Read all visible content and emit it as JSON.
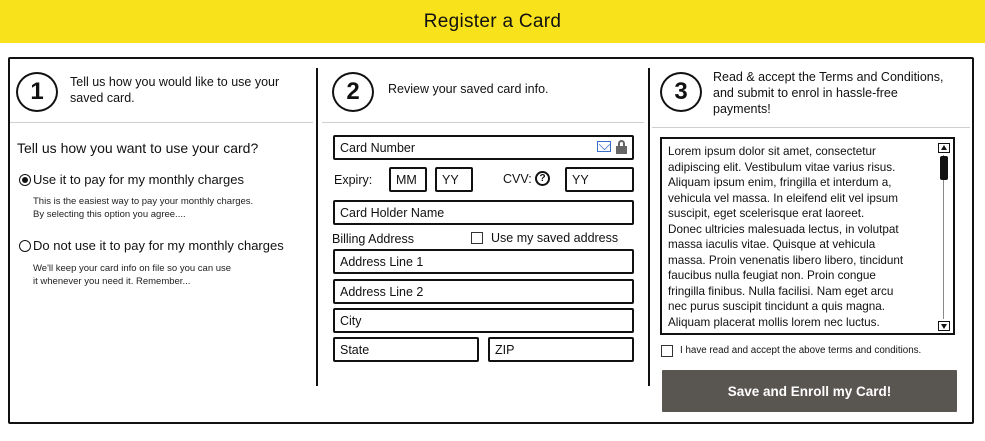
{
  "header": {
    "title": "Register a Card"
  },
  "step1": {
    "number": "1",
    "text_line1": "Tell us how you would like to use your",
    "text_line2": "saved card.",
    "question": "Tell us how you want to use your card?",
    "option1": {
      "label": "Use it to pay for my monthly charges",
      "selected": true,
      "desc_line1": "This is the easiest way to pay your monthly charges.",
      "desc_line2": "By selecting this option you agree...."
    },
    "option2": {
      "label": "Do not use it to pay for my monthly charges",
      "selected": false,
      "desc_line1": "We'll keep your card info on file so you can use",
      "desc_line2": "it whenever you need it. Remember..."
    }
  },
  "step2": {
    "number": "2",
    "text": "Review your saved card info.",
    "card_number": "Card Number",
    "expiry_label": "Expiry:",
    "expiry_month": "MM",
    "expiry_year": "YY",
    "cvv_label": "CVV:",
    "cvv_value": "YY",
    "card_holder": "Card Holder Name",
    "billing_label": "Billing Address",
    "use_saved_label": "Use my saved address",
    "address1": "Address Line 1",
    "address2": "Address Line 2",
    "city": "City",
    "state": "State",
    "zip": "ZIP",
    "icons": {
      "mail": "mail-icon",
      "lock": "lock-icon",
      "help": "help-icon"
    }
  },
  "step3": {
    "number": "3",
    "text_line1": "Read & accept the Terms and Conditions,",
    "text_line2": "and submit to enrol in hassle-free",
    "text_line3": "payments!",
    "terms": [
      "Lorem ipsum dolor sit amet, consectetur",
      "adipiscing elit. Vestibulum vitae varius risus.",
      "Aliquam ipsum enim, fringilla et interdum a,",
      "vehicula vel massa. In eleifend elit vel ipsum",
      "suscipit, eget scelerisque erat laoreet.",
      "Donec ultricies malesuada lectus, in volutpat",
      "massa iaculis vitae. Quisque at vehicula",
      "massa. Proin venenatis libero libero, tincidunt",
      "faucibus nulla feugiat non. Proin congue",
      "fringilla finibus. Nulla facilisi. Nam eget arcu",
      "nec purus suscipit tincidunt a quis magna.",
      "Aliquam placerat mollis lorem nec luctus."
    ],
    "accept_label": "I have read and accept the above terms and conditions.",
    "submit_label": "Save and Enroll my Card!"
  },
  "colors": {
    "header_bg": "#f8e21b",
    "button_bg": "#595551",
    "mail_icon": "#3a6fc9"
  }
}
